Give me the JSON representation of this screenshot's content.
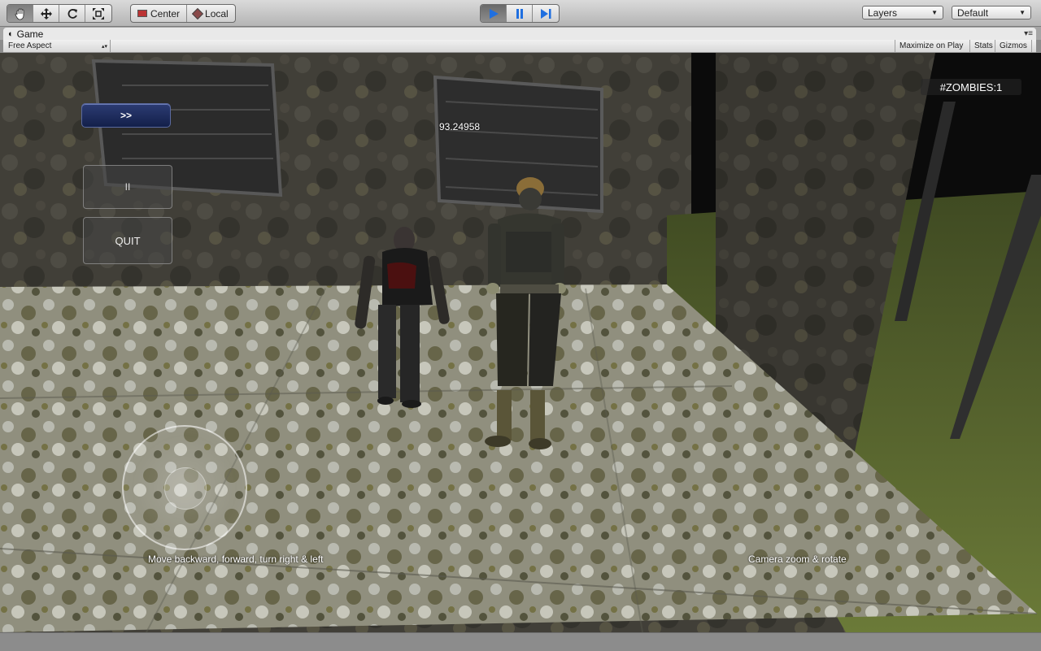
{
  "toolbar": {
    "tools": [
      {
        "icon": "hand-icon"
      },
      {
        "icon": "move-icon"
      },
      {
        "icon": "rotate-icon"
      },
      {
        "icon": "scale-icon"
      }
    ],
    "pivot_center": "Center",
    "pivot_local": "Local",
    "play_icons": [
      "play-icon",
      "pause-icon",
      "step-icon"
    ],
    "layers_label": "Layers",
    "layout_label": "Default"
  },
  "game_window": {
    "tab_title": "Game",
    "aspect_label": "Free Aspect",
    "maximize_label": "Maximize on Play",
    "stats_label": "Stats",
    "gizmos_label": "Gizmos"
  },
  "hud": {
    "forward_button": ">>",
    "pause_button": "II",
    "quit_button": "QUIT",
    "timer_value": "93.24958",
    "zombie_counter": "#ZOMBIES:1",
    "move_hint": "Move backward, forward, turn right & left",
    "camera_hint": "Camera zoom & rotate"
  },
  "colors": {
    "play_active": "#1f6fe0",
    "hud_button_blue": "#1a2756"
  }
}
